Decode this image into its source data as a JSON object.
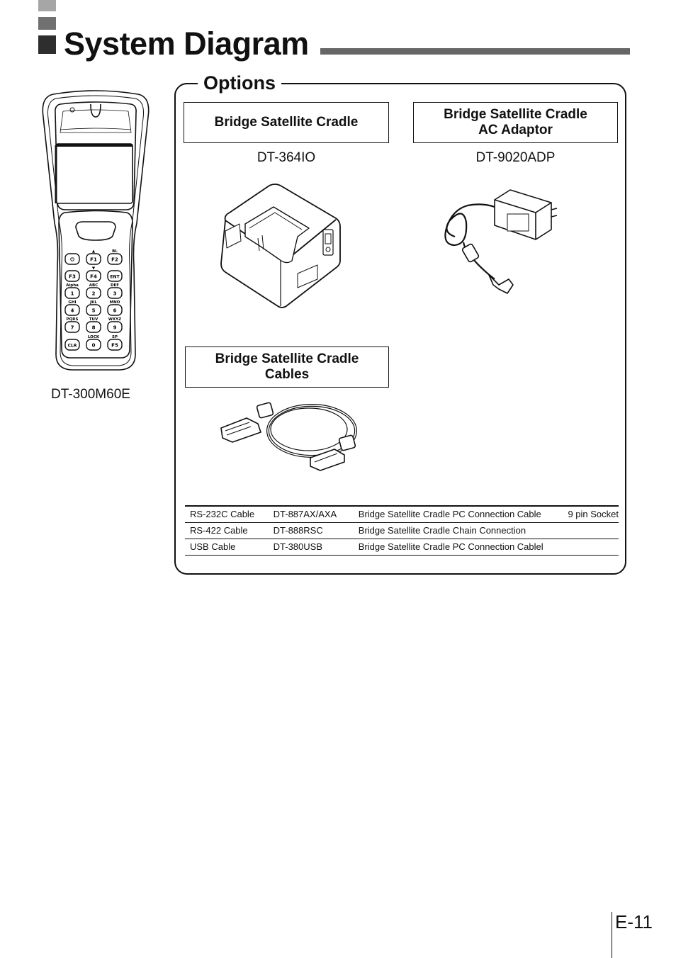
{
  "page": {
    "title": "System Diagram",
    "page_number": "E-11"
  },
  "device": {
    "model": "DT-300M60E",
    "keypad": [
      {
        "key": "⏻",
        "label": ""
      },
      {
        "key": "F1",
        "label": "▲"
      },
      {
        "key": "F2",
        "label": "BL"
      },
      {
        "key": "F3",
        "label": ""
      },
      {
        "key": "F4",
        "label": "▼"
      },
      {
        "key": "ENT",
        "label": ""
      },
      {
        "key": "1",
        "label": "Alpha"
      },
      {
        "key": "2",
        "label": "ABC"
      },
      {
        "key": "3",
        "label": "DEF"
      },
      {
        "key": "4",
        "label": "GHI"
      },
      {
        "key": "5",
        "label": "JKL"
      },
      {
        "key": "6",
        "label": "MNO"
      },
      {
        "key": "7",
        "label": "PQRS"
      },
      {
        "key": "8",
        "label": "TUV"
      },
      {
        "key": "9",
        "label": "WXYZ"
      },
      {
        "key": "CLR",
        "label": ""
      },
      {
        "key": "0",
        "label": "LOCK"
      },
      {
        "key": "F5",
        "label": "SP"
      }
    ]
  },
  "options": {
    "heading": "Options",
    "items": [
      {
        "name_line1": "Bridge Satellite Cradle",
        "name_line2": "",
        "model": "DT-364IO"
      },
      {
        "name_line1": "Bridge Satellite Cradle",
        "name_line2": "AC Adaptor",
        "model": "DT-9020ADP"
      },
      {
        "name_line1": "Bridge Satellite Cradle",
        "name_line2": "Cables",
        "model": ""
      }
    ],
    "cable_table": [
      {
        "type": "RS-232C Cable",
        "model": "DT-887AX/AXA",
        "description": "Bridge Satellite Cradle PC Connection Cable",
        "note": "9 pin Socket"
      },
      {
        "type": "RS-422 Cable",
        "model": "DT-888RSC",
        "description": "Bridge Satellite Cradle Chain Connection",
        "note": ""
      },
      {
        "type": "USB Cable",
        "model": "DT-380USB",
        "description": "Bridge Satellite Cradle PC Connection Cablel",
        "note": ""
      }
    ]
  }
}
